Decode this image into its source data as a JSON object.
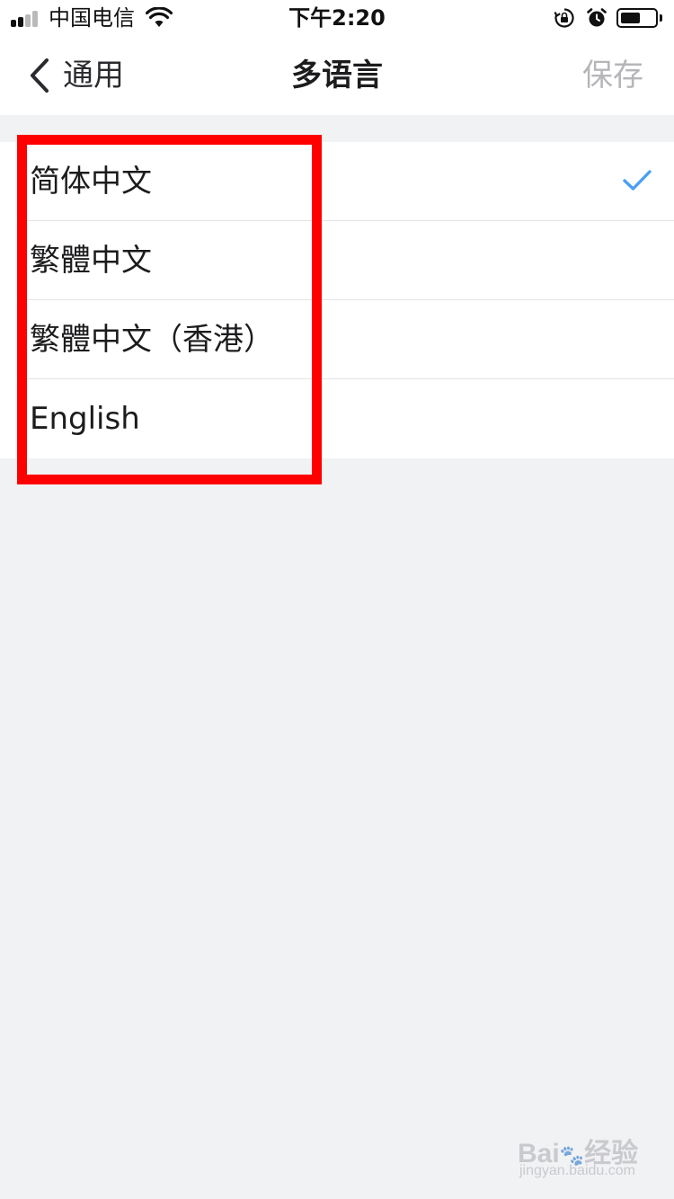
{
  "status_bar": {
    "carrier": "中国电信",
    "time": "下午2:20",
    "signal_bars": 4,
    "signal_active": 2,
    "battery_level": 0.55
  },
  "nav": {
    "back_label": "通用",
    "title": "多语言",
    "save_label": "保存"
  },
  "languages": [
    {
      "label": "简体中文",
      "selected": true
    },
    {
      "label": "繁體中文",
      "selected": false
    },
    {
      "label": "繁體中文（香港）",
      "selected": false
    },
    {
      "label": "English",
      "selected": false
    }
  ],
  "colors": {
    "accent": "#4a9ff5",
    "highlight": "#ff0000",
    "background": "#f1f2f4",
    "save_disabled": "#b5b6b9"
  },
  "watermark": {
    "logo": "Bai du 经验",
    "url": "jingyan.baidu.com"
  }
}
